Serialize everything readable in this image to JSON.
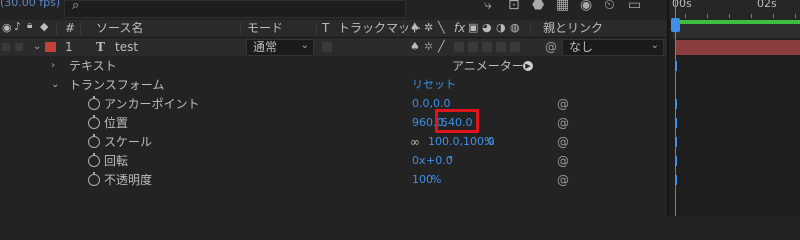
{
  "fps_label": "(30.00 fps)",
  "header": {
    "hash": "#",
    "source_name": "ソース名",
    "mode": "モード",
    "t": "T",
    "track_matte": "トラックマット",
    "switches_fx": "fx",
    "parent_link": "親とリンク"
  },
  "layer": {
    "number": "1",
    "type_icon": "T",
    "name": "test",
    "mode_value": "通常",
    "parent_value": "なし",
    "label_color": "#c4413a"
  },
  "properties": {
    "text_group": "テキスト",
    "animator_label": "アニメーター :",
    "transform_group": "トランスフォーム",
    "reset": "リセット",
    "anchor_label": "アンカーポイント",
    "anchor_value": "0.0,0.0",
    "position_label": "位置",
    "position_x": "960.0,",
    "position_y": "540.0",
    "scale_label": "スケール",
    "scale_value": "100.0,100.0",
    "scale_unit": "%",
    "rotation_label": "回転",
    "rotation_value_a": "0",
    "rotation_x": "x",
    "rotation_value_b": "+0.0",
    "rotation_deg": "°",
    "opacity_label": "不透明度",
    "opacity_value": "100",
    "opacity_unit": "%"
  },
  "timeline": {
    "tick_start": "00s",
    "tick_2s": "02s"
  },
  "colors": {
    "accent_blue": "#3f8fe6",
    "highlight_red": "#e0141b",
    "layer_bar": "#8c3d3f",
    "work_area_green": "#3fbf3f"
  }
}
